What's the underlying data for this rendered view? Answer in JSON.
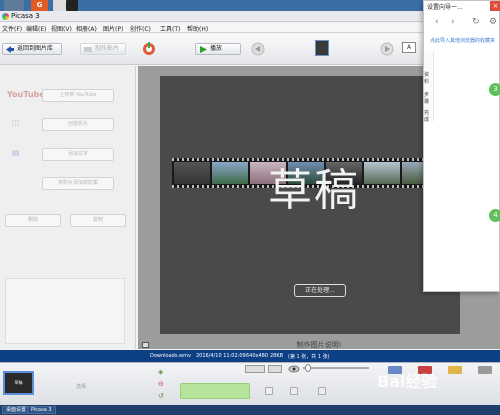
{
  "taskbar_top": {
    "app_g_label": "G"
  },
  "window": {
    "title": "Picasa 3"
  },
  "menu": [
    "文件(F)",
    "编辑(E)",
    "视图(V)",
    "相册(A)",
    "图片(P)",
    "创作(C)",
    "工具(T)",
    "帮助(H)"
  ],
  "toolbar": {
    "back_label": "返回到图片库",
    "disabled_label": "制作影片",
    "play_label": "播放"
  },
  "left_panel": {
    "youtube_logo": "YouTube",
    "upload_button": "上传到 YouTube",
    "button2": "创建影片",
    "button3": "添加文字",
    "button4": "将影片添加到影集",
    "button5": "删除",
    "button6": "复制"
  },
  "preview": {
    "watermark_text": "草稿",
    "processing_label": "正在处理...",
    "caption": "制作图片说明!"
  },
  "status": {
    "filename": "Downloads.wmv",
    "datetime": "2016/4/10 11:02:09",
    "dimensions": "640x480",
    "size": "28KB",
    "count": "(第 1 张，共 1 张)"
  },
  "tray": {
    "thumb_label": "草稿",
    "hold_label": "选择"
  },
  "taskbar_bottom": {
    "item1": "桌面设置",
    "item2": "Picasa 3"
  },
  "popup": {
    "title": "设置向导一...",
    "close": "×",
    "tip": "点此导入其他浏览器的收藏夹",
    "side_items": [
      "资料",
      "步骤",
      "完成"
    ],
    "step_a": "3",
    "step_b": "4"
  },
  "brand_watermark": {
    "text": "Bai经验"
  },
  "colors": {
    "status_bar": "#0d3f84",
    "accent_green": "#5fbf5a",
    "play_green": "#2a9d2a"
  }
}
